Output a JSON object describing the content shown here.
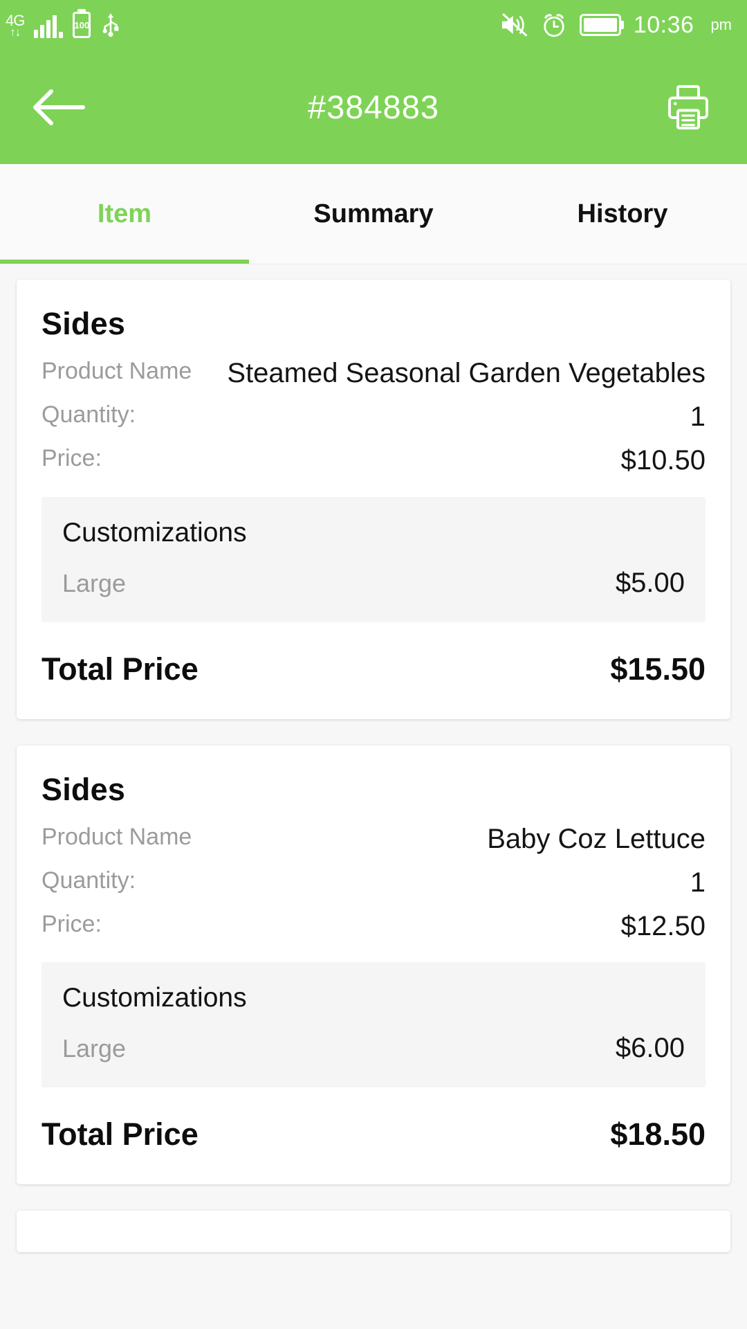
{
  "statusbar": {
    "network_label": "4G",
    "network_arrows": "↑↓",
    "battery_percent": "100",
    "time": "10:36",
    "ampm": "pm",
    "icons": {
      "signal": "signal-bars-icon",
      "battery_pct": "battery-100-icon",
      "usb": "usb-icon",
      "mute": "volume-mute-icon",
      "alarm": "alarm-clock-icon",
      "battery_full": "battery-full-icon"
    }
  },
  "appbar": {
    "title": "#384883",
    "back_label": "Back",
    "print_label": "Print"
  },
  "tabs": [
    {
      "label": "Item",
      "active": true
    },
    {
      "label": "Summary",
      "active": false
    },
    {
      "label": "History",
      "active": false
    }
  ],
  "labels": {
    "product_name": "Product Name",
    "quantity": "Quantity:",
    "price": "Price:",
    "customizations": "Customizations",
    "total_price": "Total Price"
  },
  "items": [
    {
      "category": "Sides",
      "product_name": "Steamed Seasonal Garden Vegetables",
      "quantity": "1",
      "price": "$10.50",
      "customizations": [
        {
          "name": "Large",
          "price": "$5.00"
        }
      ],
      "total_price": "$15.50"
    },
    {
      "category": "Sides",
      "product_name": "Baby Coz Lettuce",
      "quantity": "1",
      "price": "$12.50",
      "customizations": [
        {
          "name": "Large",
          "price": "$6.00"
        }
      ],
      "total_price": "$18.50"
    }
  ],
  "colors": {
    "brand_green": "#7ED356",
    "page_background": "#f7f7f7",
    "card_background": "#ffffff",
    "customization_background": "#f5f5f5",
    "muted_text": "#9b9b9b"
  }
}
